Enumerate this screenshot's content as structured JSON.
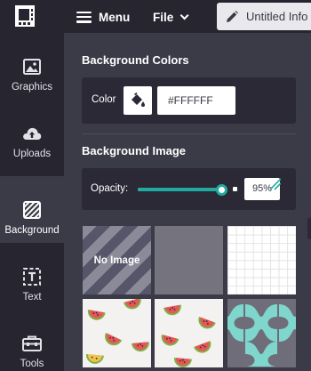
{
  "topbar": {
    "menu_label": "Menu",
    "file_label": "File",
    "title": "Untitled Info"
  },
  "sidebar": {
    "items": [
      {
        "label": "Graphics",
        "icon": "image-icon"
      },
      {
        "label": "Uploads",
        "icon": "cloud-upload-icon"
      },
      {
        "label": "Background",
        "icon": "hatch-pattern-icon",
        "active": true
      },
      {
        "label": "Text",
        "icon": "text-box-icon"
      },
      {
        "label": "Tools",
        "icon": "toolbox-icon"
      }
    ]
  },
  "background_colors": {
    "title": "Background Colors",
    "color_label": "Color",
    "color_value": "#FFFFFF"
  },
  "background_image": {
    "title": "Background Image",
    "opacity_label": "Opacity:",
    "opacity_value": "95%",
    "opacity_fraction": 0.95,
    "tiles": [
      {
        "label": "No Image"
      },
      {
        "label": ""
      },
      {
        "label": ""
      },
      {
        "label": ""
      },
      {
        "label": ""
      },
      {
        "label": ""
      }
    ]
  },
  "colors": {
    "accent": "#23aaa0",
    "sidebar_bg": "#262530",
    "panel_bg": "#3b3a47",
    "card_bg": "#2a2935"
  }
}
